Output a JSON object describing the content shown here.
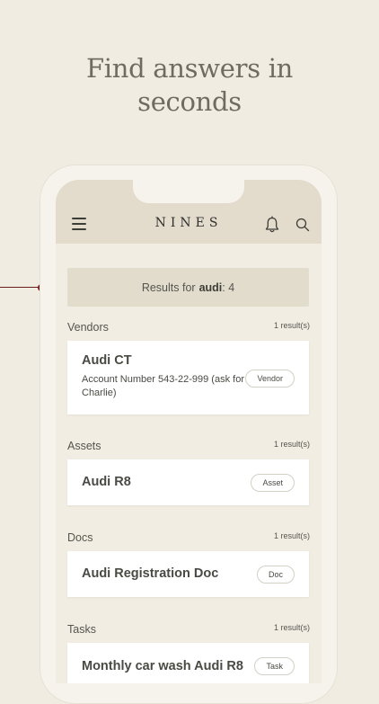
{
  "headline": {
    "line1": "Find answers in",
    "line2": "seconds"
  },
  "app": {
    "brand": "NINES"
  },
  "search": {
    "prefix": "Results for",
    "term": "audi",
    "suffix": ": 4"
  },
  "sections": [
    {
      "title": "Vendors",
      "count": "1 result(s)",
      "item": {
        "title": "Audi CT",
        "subtitle": "Account Number 543-22-999 (ask for Charlie)",
        "tag": "Vendor"
      }
    },
    {
      "title": "Assets",
      "count": "1 result(s)",
      "item": {
        "title": "Audi R8",
        "tag": "Asset"
      }
    },
    {
      "title": "Docs",
      "count": "1 result(s)",
      "item": {
        "title": "Audi Registration Doc",
        "tag": "Doc"
      }
    },
    {
      "title": "Tasks",
      "count": "1 result(s)",
      "item": {
        "title": "Monthly car wash Audi R8",
        "tag": "Task"
      }
    }
  ],
  "colors": {
    "background": "#f0ece2",
    "appbar": "#e3dccd",
    "accent_dot": "#7a1f1f"
  },
  "icons": [
    "menu-icon",
    "bell-icon",
    "search-icon"
  ]
}
